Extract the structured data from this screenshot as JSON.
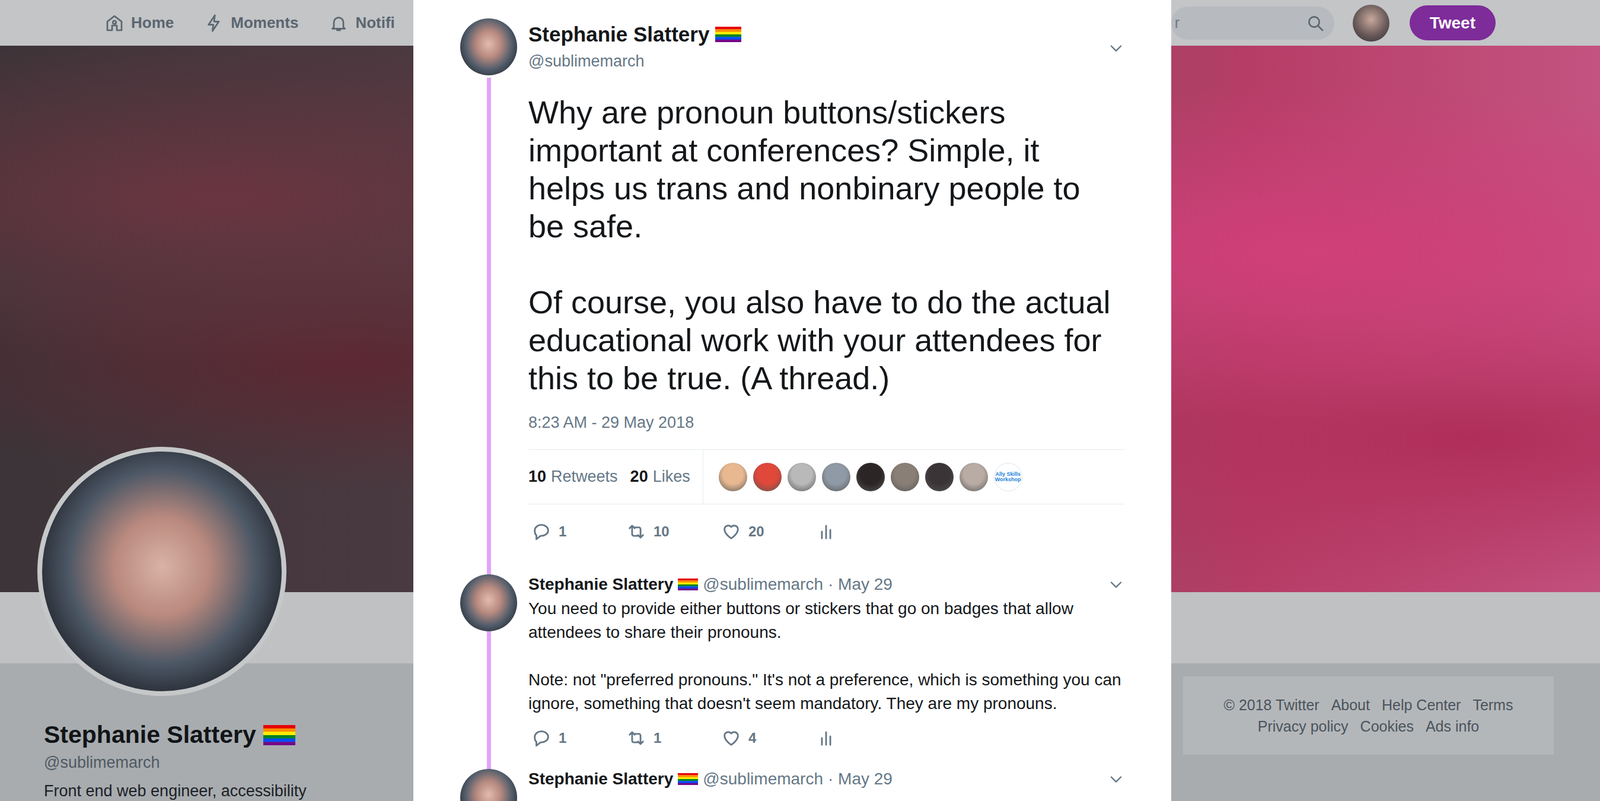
{
  "nav": {
    "items": [
      {
        "label": "Home"
      },
      {
        "label": "Moments"
      },
      {
        "label": "Notifi"
      }
    ],
    "search": {
      "placeholder": "r"
    },
    "tweet_button": "Tweet"
  },
  "profile": {
    "name": "Stephanie Slattery",
    "handle": "@sublimemarch",
    "bio": "Front end web engineer, accessibility"
  },
  "footer": {
    "rows": [
      [
        "© 2018 Twitter",
        "About",
        "Help Center",
        "Terms"
      ],
      [
        "Privacy policy",
        "Cookies",
        "Ads info"
      ]
    ]
  },
  "modal": {
    "tweet": {
      "name": "Stephanie Slattery",
      "handle": "@sublimemarch",
      "text": [
        "Why are pronoun buttons/stickers important at conferences? Simple, it helps us trans and nonbinary people to be safe.",
        "Of course, you also have to do the actual educational work with your attendees for this to be true. (A thread.)"
      ],
      "time": "8:23 AM - 29 May 2018",
      "stats": {
        "retweets": {
          "count": "10",
          "label": "Retweets"
        },
        "likes": {
          "count": "20",
          "label": "Likes"
        }
      },
      "retweeters": [
        {
          "kind": "photo",
          "color": "#e8b890"
        },
        {
          "kind": "photo",
          "color": "#e0483a"
        },
        {
          "kind": "photo",
          "color": "#b9b9b9"
        },
        {
          "kind": "photo",
          "color": "#8f9aa6"
        },
        {
          "kind": "photo",
          "color": "#2b2625"
        },
        {
          "kind": "photo",
          "color": "#8a7f76"
        },
        {
          "kind": "photo",
          "color": "#3a3436"
        },
        {
          "kind": "photo",
          "color": "#b9aca4"
        },
        {
          "kind": "logo",
          "text": "Ally Skills Workshop"
        }
      ],
      "actions": [
        {
          "kind": "reply",
          "count": "1"
        },
        {
          "kind": "retweet",
          "count": "10"
        },
        {
          "kind": "like",
          "count": "20"
        },
        {
          "kind": "analytics"
        }
      ]
    },
    "replies": [
      {
        "name": "Stephanie Slattery",
        "handle": "@sublimemarch",
        "date": "· May 29",
        "text": [
          "You need to provide either buttons or stickers that go on badges that allow attendees to share their pronouns.",
          "Note: not \"preferred pronouns.\" It's not a preference, which is something you can ignore, something that doesn't seem mandatory. They are my pronouns."
        ],
        "actions": [
          {
            "kind": "reply",
            "count": "1"
          },
          {
            "kind": "retweet",
            "count": "1"
          },
          {
            "kind": "like",
            "count": "4"
          },
          {
            "kind": "analytics"
          }
        ]
      },
      {
        "name": "Stephanie Slattery",
        "handle": "@sublimemarch",
        "date": "· May 29",
        "text": [],
        "actions": []
      }
    ]
  }
}
